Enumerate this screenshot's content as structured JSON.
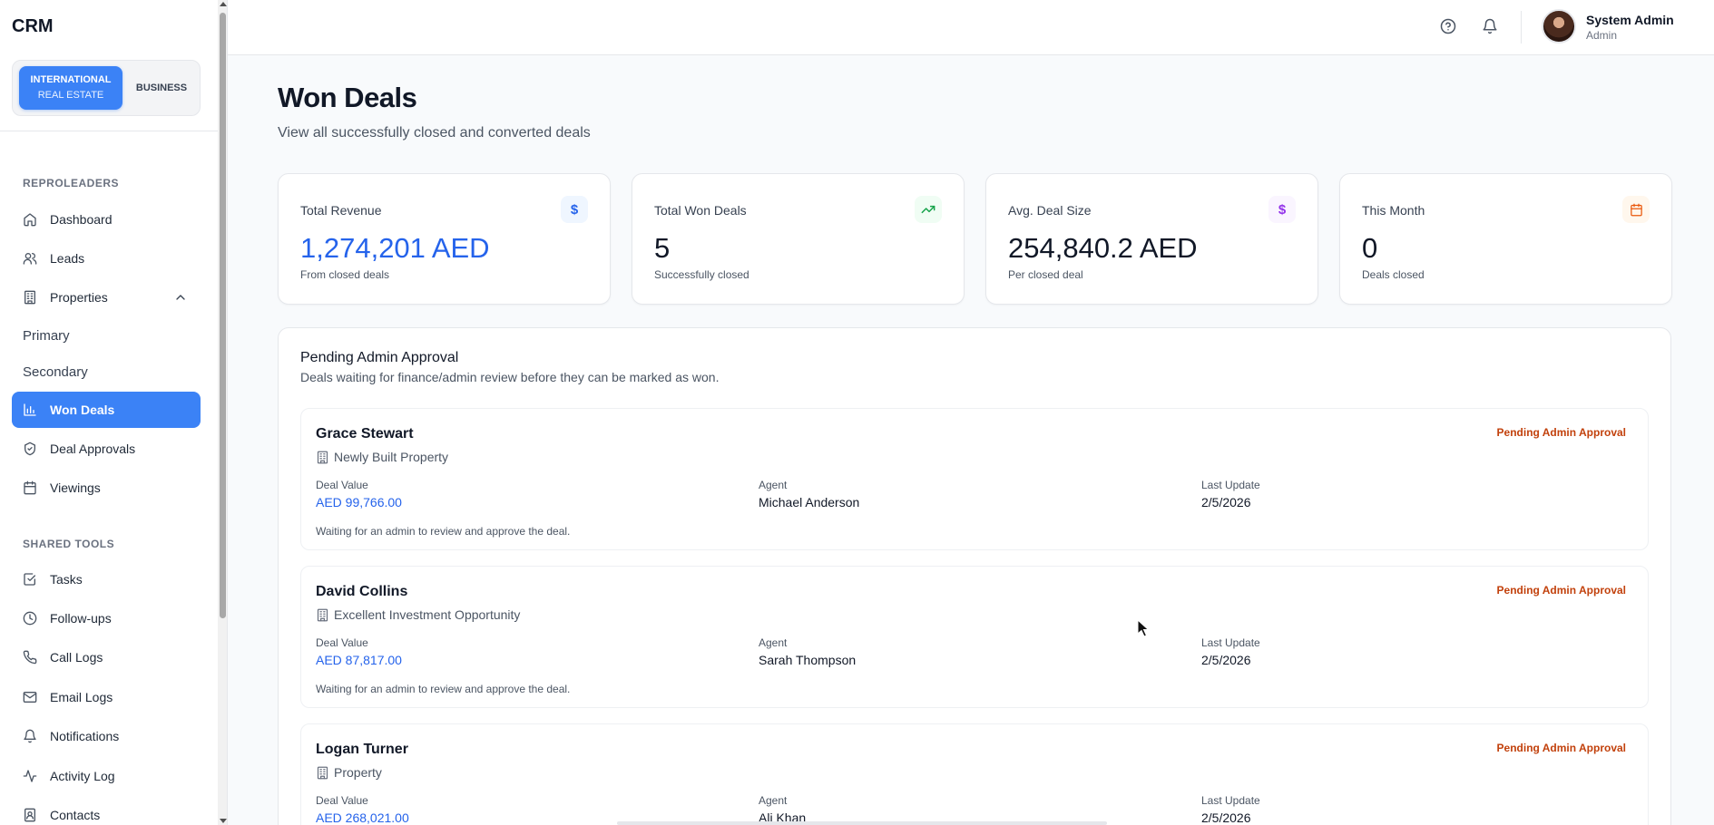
{
  "app": {
    "brand": "CRM"
  },
  "switcher": {
    "active_line1": "INTERNATIONAL",
    "active_line2": "REAL ESTATE",
    "inactive": "BUSINESS"
  },
  "sidebar": {
    "section1": "REPROLEADERS",
    "items": [
      {
        "label": "Dashboard",
        "icon": "home-icon"
      },
      {
        "label": "Leads",
        "icon": "users-icon"
      },
      {
        "label": "Properties",
        "icon": "building-icon"
      },
      {
        "label": "Won Deals",
        "icon": "bar-chart-icon"
      },
      {
        "label": "Deal Approvals",
        "icon": "shield-check-icon"
      },
      {
        "label": "Viewings",
        "icon": "calendar-icon"
      }
    ],
    "sub_items": [
      "Primary",
      "Secondary"
    ],
    "section2": "SHARED TOOLS",
    "tools": [
      {
        "label": "Tasks",
        "icon": "check-square-icon"
      },
      {
        "label": "Follow-ups",
        "icon": "clock-icon"
      },
      {
        "label": "Call Logs",
        "icon": "phone-icon"
      },
      {
        "label": "Email Logs",
        "icon": "mail-icon"
      },
      {
        "label": "Notifications",
        "icon": "bell-icon"
      },
      {
        "label": "Activity Log",
        "icon": "activity-icon"
      },
      {
        "label": "Contacts",
        "icon": "contacts-icon"
      }
    ]
  },
  "header": {
    "user_name": "System Admin",
    "user_role": "Admin"
  },
  "page": {
    "title": "Won Deals",
    "subtitle": "View all successfully closed and converted deals"
  },
  "stats": [
    {
      "label": "Total Revenue",
      "value": "1,274,201 AED",
      "desc": "From closed deals",
      "badge": "$",
      "badge_color": "#2563eb",
      "badge_bg": "#eff6ff"
    },
    {
      "label": "Total Won Deals",
      "value": "5",
      "desc": "Successfully closed",
      "badge": "trending-up-icon",
      "badge_color": "#16a34a",
      "badge_bg": "#f0fdf4"
    },
    {
      "label": "Avg. Deal Size",
      "value": "254,840.2 AED",
      "desc": "Per closed deal",
      "badge": "$",
      "badge_color": "#9333ea",
      "badge_bg": "#faf5ff"
    },
    {
      "label": "This Month",
      "value": "0",
      "desc": "Deals closed",
      "badge": "calendar-icon",
      "badge_color": "#ea580c",
      "badge_bg": "#fff7ed"
    }
  ],
  "pending": {
    "title": "Pending Admin Approval",
    "subtitle": "Deals waiting for finance/admin review before they can be marked as won.",
    "field_labels": {
      "value": "Deal Value",
      "agent": "Agent",
      "updated": "Last Update"
    },
    "deals": [
      {
        "name": "Grace Stewart",
        "property": "Newly Built Property",
        "status": "Pending Admin Approval",
        "value": "AED 99,766.00",
        "agent": "Michael Anderson",
        "updated": "2/5/2026",
        "note": "Waiting for an admin to review and approve the deal."
      },
      {
        "name": "David Collins",
        "property": "Excellent Investment Opportunity",
        "status": "Pending Admin Approval",
        "value": "AED 87,817.00",
        "agent": "Sarah Thompson",
        "updated": "2/5/2026",
        "note": "Waiting for an admin to review and approve the deal."
      },
      {
        "name": "Logan Turner",
        "property": "Property",
        "status": "Pending Admin Approval",
        "value": "AED 268,021.00",
        "agent": "Ali Khan",
        "updated": "2/5/2026",
        "note": ""
      }
    ]
  }
}
